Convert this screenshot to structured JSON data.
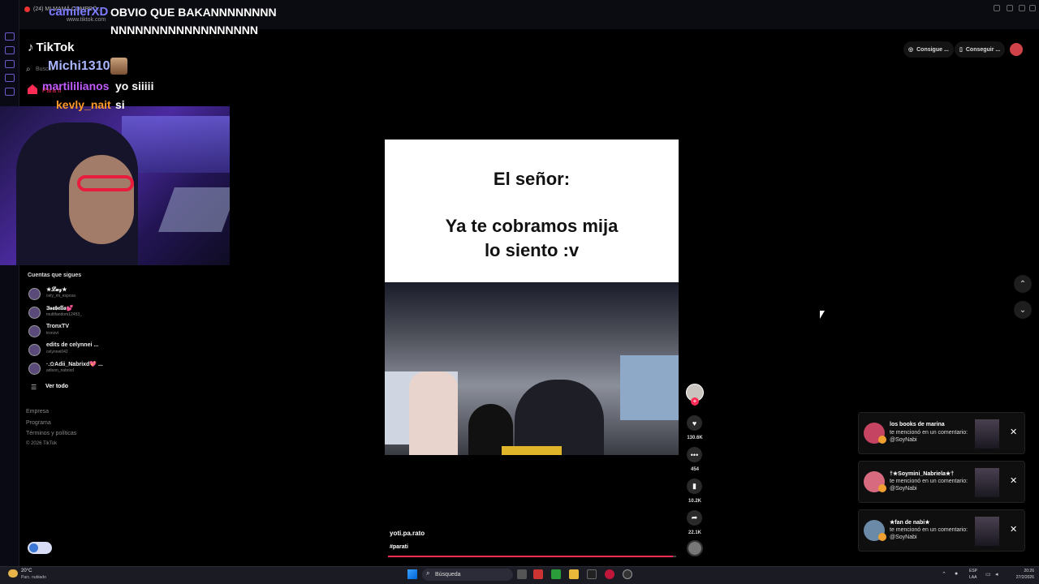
{
  "browser": {
    "tab_title": "(24) MI MAMÁ COMPRÓ...",
    "url": "www.tiktok.com"
  },
  "chat": {
    "messages": [
      {
        "user": "camilerXD",
        "text": "OBVIO QUE BAKANNNNNNNNNNNNNNNNNNNNNNNNNN"
      },
      {
        "user": "Michi1310",
        "text": ""
      },
      {
        "user": "martililianos",
        "text": "yo siiiii"
      },
      {
        "user": "kevly_nait",
        "text": "si"
      }
    ]
  },
  "tiktok": {
    "logo": "TikTok",
    "search_placeholder": "Buscar",
    "nav_for_you": "Para ti",
    "following_title": "Cuentas que sigues",
    "following": [
      {
        "name": "★𝓛𝓾𝔃★",
        "handle": "cely_mi_esposa"
      },
      {
        "name": "𝕴𝖘𝖆𝖇𝖊𝖑𝖑𝖆💕",
        "handle": "multifandom12453_"
      },
      {
        "name": "TronxTV",
        "handle": "tronxvt"
      },
      {
        "name": "edits de celynnei ...",
        "handle": "celynnei042"
      },
      {
        "name": "·.✩Adii_Nabrixd💖 ...",
        "handle": "adison_nabrixd"
      }
    ],
    "see_all": "Ver todo",
    "footer": [
      "Empresa",
      "Programa",
      "Términos y políticas",
      "© 2026 TikTok"
    ],
    "header_get_coins": "Consigue ...",
    "header_get_app": "Conseguir ..."
  },
  "video": {
    "caption_line1": "El señor:",
    "caption_line2a": "Ya te cobramos mija",
    "caption_line2b": "lo siento :v",
    "author": "yoti.pa.rato",
    "hashtag": "#parati",
    "progress": 0.99,
    "likes": "130.6K",
    "comments": "454",
    "saves": "10.2K",
    "shares": "22.1K"
  },
  "notifications": [
    {
      "title": "los books de marina",
      "text": "te mencionó en un comentario: @SoyNabi"
    },
    {
      "title": "†★Soymini_Nabriela★†",
      "text": "te mencionó en un comentario: @SoyNabi"
    },
    {
      "title": "★fan de nabi★",
      "text": "te mencionó en un comentario: @SoyNabi"
    }
  ],
  "taskbar": {
    "weather_temp": "20°C",
    "weather_desc": "Parc. nublado",
    "search_label": "Búsqueda",
    "lang1": "ESP",
    "lang2": "LAA",
    "time": "20:26",
    "date": "27/2/2026"
  }
}
